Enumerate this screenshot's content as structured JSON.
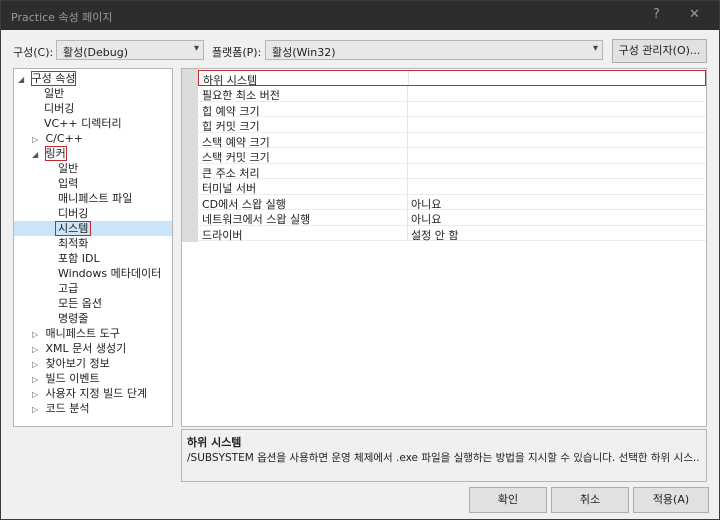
{
  "window": {
    "title": "Practice 속성 페이지",
    "help_glyph": "?",
    "close_glyph": "✕"
  },
  "config": {
    "label": "구성(C):",
    "value": "활성(Debug)"
  },
  "platform": {
    "label": "플랫폼(P):",
    "value": "활성(Win32)"
  },
  "config_manager_label": "구성 관리자(O)...",
  "tree": {
    "items": [
      {
        "label": "구성 속성",
        "level": 0,
        "expander": "◢"
      },
      {
        "label": "일반",
        "level": 1
      },
      {
        "label": "디버깅",
        "level": 1
      },
      {
        "label": "VC++ 디렉터리",
        "level": 1
      },
      {
        "label": "C/C++",
        "level": 1,
        "expander": "▷"
      },
      {
        "label": "링커",
        "level": 1,
        "expander": "◢"
      },
      {
        "label": "일반",
        "level": 2
      },
      {
        "label": "입력",
        "level": 2
      },
      {
        "label": "매니페스트 파일",
        "level": 2
      },
      {
        "label": "디버깅",
        "level": 2
      },
      {
        "label": "시스템",
        "level": 2
      },
      {
        "label": "최적화",
        "level": 2
      },
      {
        "label": "포함 IDL",
        "level": 2
      },
      {
        "label": "Windows 메타데이터",
        "level": 2
      },
      {
        "label": "고급",
        "level": 2
      },
      {
        "label": "모든 옵션",
        "level": 2
      },
      {
        "label": "명령줄",
        "level": 2
      },
      {
        "label": "매니페스트 도구",
        "level": 1,
        "expander": "▷"
      },
      {
        "label": "XML 문서 생성기",
        "level": 1,
        "expander": "▷"
      },
      {
        "label": "찾아보기 정보",
        "level": 1,
        "expander": "▷"
      },
      {
        "label": "빌드 이벤트",
        "level": 1,
        "expander": "▷"
      },
      {
        "label": "사용자 지정 빌드 단계",
        "level": 1,
        "expander": "▷"
      },
      {
        "label": "코드 분석",
        "level": 1,
        "expander": "▷"
      }
    ]
  },
  "properties": [
    {
      "name": "하위 시스템",
      "value": ""
    },
    {
      "name": "필요한 최소 버전",
      "value": ""
    },
    {
      "name": "힙 예약 크기",
      "value": ""
    },
    {
      "name": "힙 커밋 크기",
      "value": ""
    },
    {
      "name": "스택 예약 크기",
      "value": ""
    },
    {
      "name": "스택 커밋 크기",
      "value": ""
    },
    {
      "name": "큰 주소 처리",
      "value": ""
    },
    {
      "name": "터미널 서버",
      "value": ""
    },
    {
      "name": "CD에서 스왑 실행",
      "value": "아니요"
    },
    {
      "name": "네트워크에서 스왑 실행",
      "value": "아니요"
    },
    {
      "name": "드라이버",
      "value": "설정 안 함"
    }
  ],
  "description": {
    "title": "하위 시스템",
    "text": "/SUBSYSTEM 옵션을 사용하면 운영 체제에서 .exe 파일을 실행하는 방법을 지시할 수 있습니다. 선택한 하위 시스..."
  },
  "buttons": {
    "ok": "확인",
    "cancel": "취소",
    "apply": "적용(A)"
  },
  "colors": {
    "selection": "#cce4f7",
    "highlight_box": "#c0282d",
    "titlebar": "#2d2d30"
  }
}
